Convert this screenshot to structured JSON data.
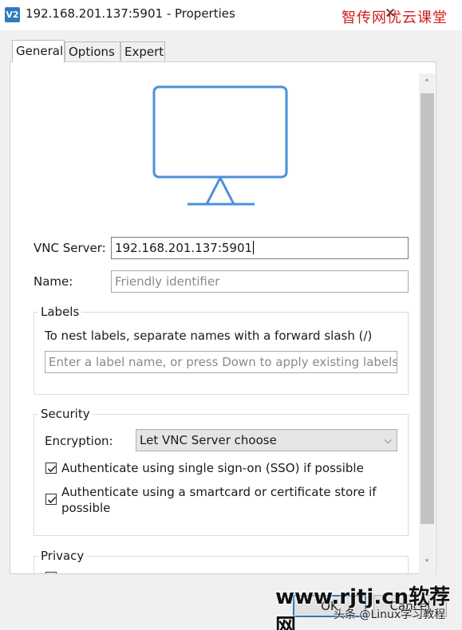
{
  "window": {
    "app_icon_text": "V2",
    "title": "192.168.201.137:5901 - Properties",
    "overlay_text": "智传网优云课堂"
  },
  "tabs": [
    {
      "label": "General",
      "active": true
    },
    {
      "label": "Options",
      "active": false
    },
    {
      "label": "Expert",
      "active": false
    }
  ],
  "general": {
    "vnc_server_label": "VNC Server:",
    "vnc_server_value": "192.168.201.137:5901",
    "name_label": "Name:",
    "name_placeholder": "Friendly identifier",
    "labels_group": {
      "title": "Labels",
      "hint": "To nest labels, separate names with a forward slash (/)",
      "input_placeholder": "Enter a label name, or press Down to apply existing labels"
    },
    "security_group": {
      "title": "Security",
      "encryption_label": "Encryption:",
      "encryption_value": "Let VNC Server choose",
      "sso_label": "Authenticate using single sign-on (SSO) if possible",
      "sso_checked": true,
      "smartcard_label_line1": "Authenticate using a smartcard or certificate store if",
      "smartcard_label_line2": "possible",
      "smartcard_checked": true
    },
    "privacy_group": {
      "title": "Privacy"
    }
  },
  "buttons": {
    "ok": "OK",
    "cancel": "Cancel"
  },
  "watermarks": {
    "site": "www.rjtj.cn软荐网",
    "credit": "头条 @Linux学习教程"
  },
  "colors": {
    "accent": "#2f7bbf",
    "monitor_stroke": "#4a90d9",
    "watermark_red": "#d21d1d"
  }
}
